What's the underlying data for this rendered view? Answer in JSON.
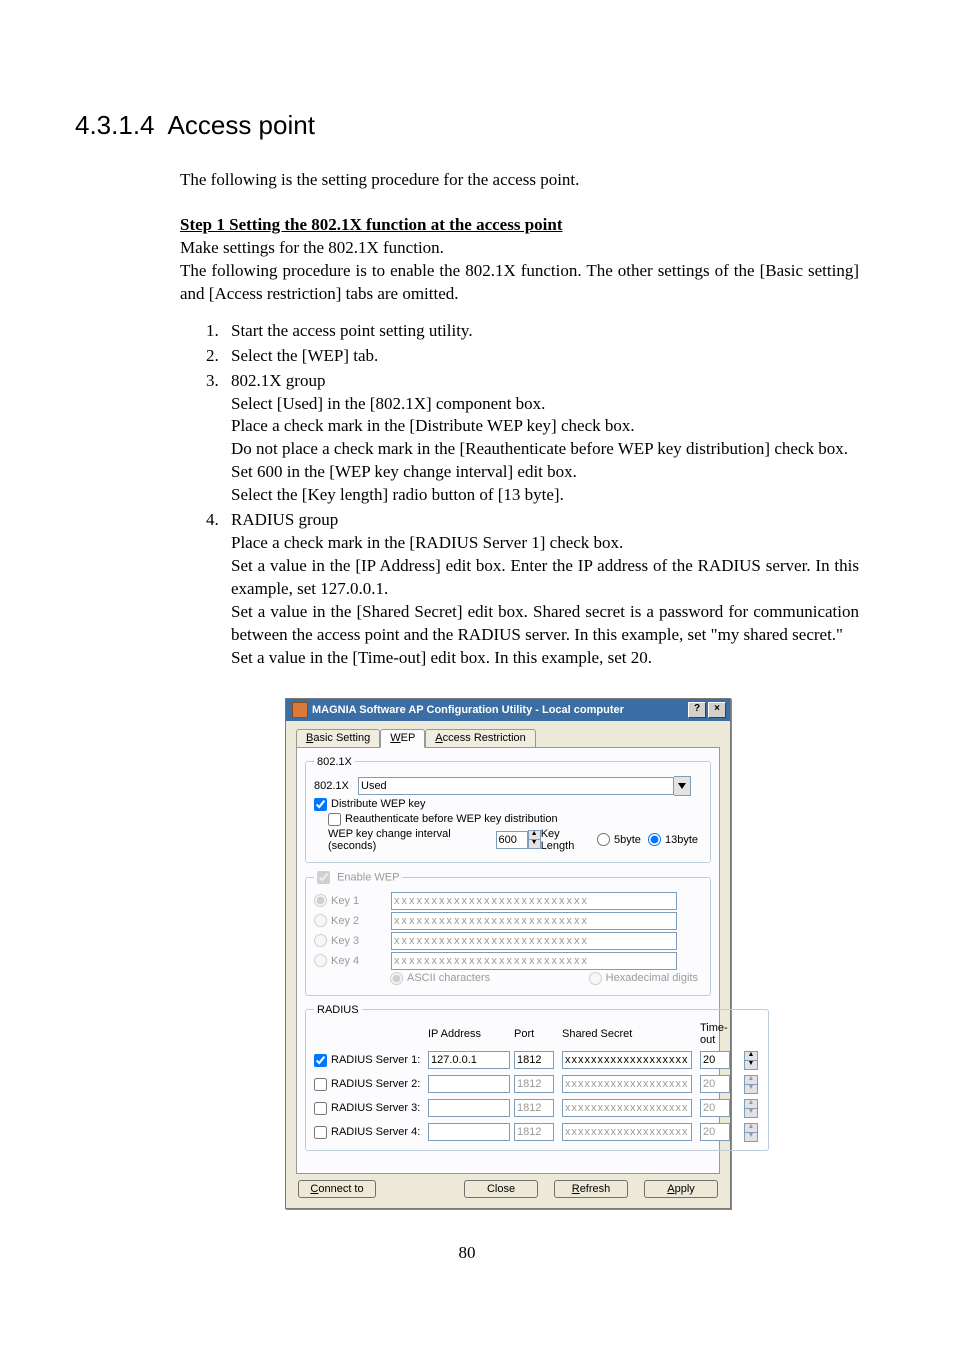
{
  "page_number": "80",
  "section": {
    "number": "4.3.1.4",
    "title": "Access point"
  },
  "intro": "The following is the setting procedure for the access point.",
  "step_heading": "Step 1  Setting the 802.1X function at the access point",
  "p1": "Make settings for the 802.1X function.",
  "p2": "The following procedure is to enable the 802.1X function.  The other settings of the [Basic setting] and [Access restriction] tabs are omitted.",
  "steps": {
    "s1": "Start the access point setting utility.",
    "s2": "Select the [WEP] tab.",
    "s3": "802.1X group",
    "s3a": "Select [Used] in the [802.1X] component box.",
    "s3b": "Place a check mark in the [Distribute WEP key] check box.",
    "s3c": "Do not place a check mark in the [Reauthenticate before WEP key distribution] check box.",
    "s3d": "Set 600 in the [WEP key change interval] edit box.",
    "s3e": "Select the [Key length] radio button of [13 byte].",
    "s4": "RADIUS group",
    "s4a": "Place a check mark in the [RADIUS Server 1] check box.",
    "s4b": "Set a value in the [IP Address] edit box.  Enter the IP address of the RADIUS server.  In this example, set 127.0.0.1.",
    "s4c": "Set a value in the [Shared Secret] edit box.  Shared secret is a password for communication between the access point and the RADIUS server.  In this example, set \"my shared secret.\"",
    "s4d": "Set a value in the [Time-out] edit box.  In this example, set 20."
  },
  "dialog": {
    "title": "MAGNIA Software AP Configuration Utility - Local computer",
    "help_btn": "?",
    "close_btn": "×",
    "tabs": {
      "basic_letter": "B",
      "basic_rest": "asic Setting",
      "wep_letter": "W",
      "wep_rest": "EP",
      "access_letter": "A",
      "access_rest": "ccess Restriction"
    },
    "group_8021x": {
      "legend": "802.1X",
      "label_8021x": "802.1X",
      "value_8021x": "Used",
      "distribute_label": "Distribute WEP key",
      "reauth_label": "Reauthenticate before WEP key distribution",
      "interval_label": "WEP key change interval (seconds)",
      "interval_value": "600",
      "keylen_label": "Key Length",
      "keylen_5": "5byte",
      "keylen_13": "13byte"
    },
    "group_wep": {
      "legend": "Enable WEP",
      "key1": "Key 1",
      "key2": "Key 2",
      "key3": "Key 3",
      "key4": "Key 4",
      "mask": "xxxxxxxxxxxxxxxxxxxxxxxxxx",
      "ascii": "ASCII characters",
      "hex": "Hexadecimal digits"
    },
    "group_radius": {
      "legend": "RADIUS",
      "hdr_ip": "IP Address",
      "hdr_port": "Port",
      "hdr_secret": "Shared Secret",
      "hdr_timeout": "Time-out",
      "row1_label": "RADIUS Server 1:",
      "row2_label": "RADIUS Server 2:",
      "row3_label": "RADIUS Server 3:",
      "row4_label": "RADIUS Server 4:",
      "ip1": "127.0.0.1",
      "port_default": "1812",
      "secret_mask": "xxxxxxxxxxxxxxxxxxxx",
      "timeout1": "20",
      "timeout_disabled": "20"
    },
    "footer": {
      "connect_letter": "C",
      "connect_rest": "onnect to",
      "close": "Close",
      "refresh_letter": "R",
      "refresh_rest": "efresh",
      "apply_letter": "A",
      "apply_rest": "pply"
    }
  }
}
